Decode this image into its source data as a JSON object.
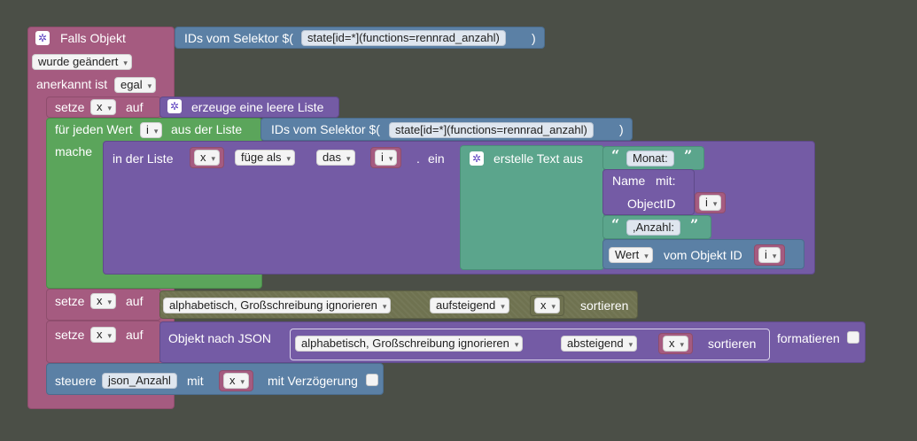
{
  "trigger": {
    "title": "Falls Objekt",
    "selector_label": "IDs vom Selektor $(",
    "selector_value": "state[id=*](functions=rennrad_anzahl)",
    "selector_close": ")",
    "changed_option": "wurde geändert",
    "ack_label": "anerkannt ist",
    "ack_option": "egal"
  },
  "set1": {
    "label": "setze",
    "var": "x",
    "to": "auf",
    "create_list": "erzeuge eine leere Liste"
  },
  "foreach": {
    "label": "für jeden Wert",
    "var": "i",
    "from_list": "aus der Liste",
    "selector_label": "IDs vom Selektor $(",
    "selector_value": "state[id=*](functions=rennrad_anzahl)",
    "selector_close": ")",
    "do_label": "mache"
  },
  "list_insert": {
    "in_list": "in der Liste",
    "list_var": "x",
    "mode": "füge als",
    "position": "das",
    "index_var": "i",
    "dot": ".",
    "value_label": "ein",
    "create_text": "erstelle Text aus",
    "text1": "Monat:",
    "name_label": "Name",
    "name_with": "mit:",
    "object_id": "ObjectID",
    "object_var": "i",
    "text2": ",Anzahl:",
    "value_option": "Wert",
    "of_object": "vom Objekt ID",
    "value_var": "i"
  },
  "set2": {
    "label": "setze",
    "var": "x",
    "to": "auf",
    "sort_type": "alphabetisch, Großschreibung ignorieren",
    "order": "aufsteigend",
    "list_var": "x",
    "sort_label": "sortieren"
  },
  "set3": {
    "label": "setze",
    "var": "x",
    "to": "auf",
    "to_json": "Objekt nach JSON",
    "sort_type": "alphabetisch, Großschreibung ignorieren",
    "order": "absteigend",
    "list_var": "x",
    "sort_label": "sortieren",
    "format_label": "formatieren"
  },
  "control": {
    "label": "steuere",
    "state": "json_Anzahl",
    "with": "mit",
    "var": "x",
    "delay": "mit Verzögerung"
  },
  "colors": {
    "background": "#4b4f47",
    "event": "#a55b80",
    "selector": "#5b80a5",
    "lists": "#745ba5",
    "loops": "#5ba55b",
    "text": "#5ba58c"
  }
}
